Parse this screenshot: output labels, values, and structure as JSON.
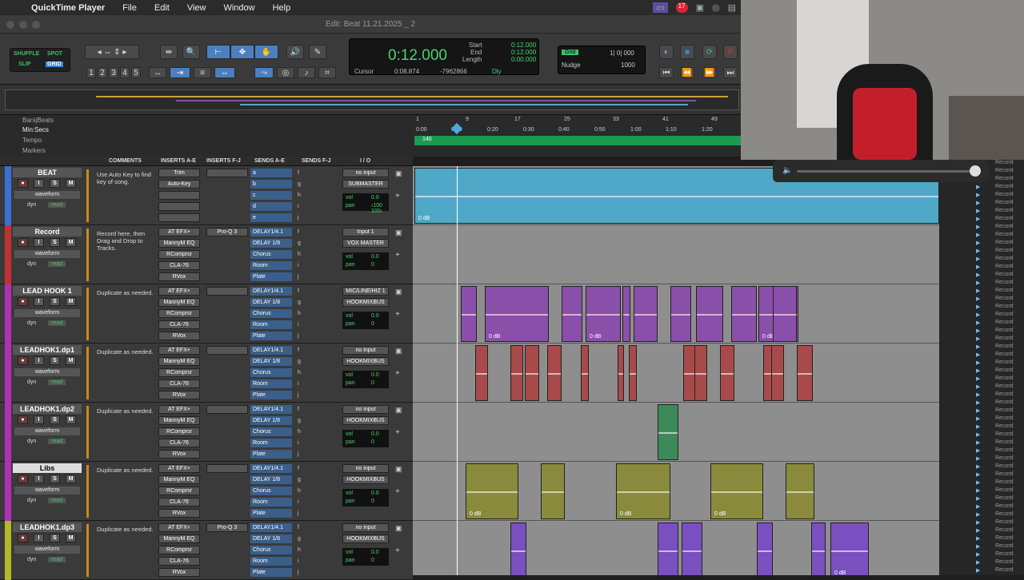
{
  "menubar": {
    "app": "QuickTime Player",
    "items": [
      "File",
      "Edit",
      "View",
      "Window",
      "Help"
    ],
    "badge": "17"
  },
  "window": {
    "title": "Edit: Beat 11.21.2025 _ 2"
  },
  "modes": {
    "shuffle": "SHUFFLE",
    "spot": "SPOT",
    "slip": "SLIP",
    "grid": "GRID"
  },
  "zoom_presets": [
    "1",
    "2",
    "3",
    "4",
    "5"
  ],
  "counter": {
    "main": "0:12.000",
    "start_label": "Start",
    "end_label": "End",
    "length_label": "Length",
    "start": "0:12.000",
    "end": "0:12.000",
    "length": "0:00.000",
    "cursor_label": "Cursor",
    "cursor": "0:08.874",
    "sample": "-7962866",
    "dly": "Dly"
  },
  "grid": {
    "label": "Grid",
    "value": "1| 0| 000",
    "nudge_label": "Nudge",
    "nudge": "1000"
  },
  "rulers": {
    "bars_label": "Bars|Beats",
    "min_label": "Min:Secs",
    "tempo_label": "Tempo",
    "markers_label": "Markers",
    "tempo_value": "140",
    "bars": [
      "1",
      "9",
      "17",
      "25",
      "33",
      "41",
      "49"
    ],
    "secs": [
      "0:00",
      "0:10",
      "0:20",
      "0:30",
      "0:40",
      "0:50",
      "1:00",
      "1:10",
      "1:20"
    ]
  },
  "columns": {
    "comments": "COMMENTS",
    "ins_ae": "INSERTS A-E",
    "ins_fj": "INSERTS F-J",
    "sends_ae": "SENDS A-E",
    "sends_fj": "SENDS F-J",
    "io": "I / O"
  },
  "common": {
    "view": "waveform",
    "dyn": "dyn",
    "read": "read",
    "vol": "vol",
    "pan": "pan",
    "rec": "",
    "solo": "S",
    "mute": "M",
    "input": "I"
  },
  "tracks": [
    {
      "name": "BEAT",
      "color": "#3b6fd6",
      "comment": "Use Auto Key to find key of song.",
      "inserts": [
        "Trim",
        "Auto-Key",
        "",
        "",
        ""
      ],
      "inserts2": [
        "",
        "",
        "",
        "",
        ""
      ],
      "sends": [
        "a",
        "b",
        "c",
        "d",
        "e"
      ],
      "sends2": [
        "f",
        "g",
        "h",
        "i",
        "j"
      ],
      "input": "no input",
      "output": "SUBMASTER",
      "vol": "0.0",
      "pan": "‹100  100›"
    },
    {
      "name": "Record",
      "color": "#c23131",
      "comment": "Record here, then Drag and Drop to Tracks.",
      "inserts": [
        "AT EFX+",
        "MannyM EQ",
        "RComprsr",
        "CLA-76",
        "RVox"
      ],
      "inserts2": [
        "Pro-Q 3",
        "",
        "",
        "",
        ""
      ],
      "sends": [
        "DELAY1/4.1",
        "DELAY 1/8",
        "Chorus",
        "Room",
        "Plate"
      ],
      "sends2": [
        "f",
        "g",
        "h",
        "i",
        "j"
      ],
      "input": "Input 1",
      "output": "VOX MASTER",
      "vol": "0.0",
      "pan": "0"
    },
    {
      "name": "LEAD HOOK 1",
      "color": "#b02fb5",
      "comment": "Duplicate as needed.",
      "inserts": [
        "AT EFX+",
        "MannyM EQ",
        "RComprsr",
        "CLA-76",
        "RVox"
      ],
      "inserts2": [
        "",
        "",
        "",
        "",
        ""
      ],
      "sends": [
        "DELAY1/4.1",
        "DELAY 1/8",
        "Chorus",
        "Room",
        "Plate"
      ],
      "sends2": [
        "f",
        "g",
        "h",
        "i",
        "j"
      ],
      "input": "MIC/LINE/HIZ 1",
      "output": "HOOKMIXBUS",
      "vol": "0.0",
      "pan": "0"
    },
    {
      "name": "LEADHOK1.dp1",
      "color": "#b02fb5",
      "comment": "Duplicate as needed.",
      "inserts": [
        "AT EFX+",
        "MannyM EQ",
        "RComprsr",
        "CLA-76",
        "RVox"
      ],
      "inserts2": [
        "",
        "",
        "",
        "",
        ""
      ],
      "sends": [
        "DELAY1/4.1",
        "DELAY 1/8",
        "Chorus",
        "Room",
        "Plate"
      ],
      "sends2": [
        "f",
        "g",
        "h",
        "i",
        "j"
      ],
      "input": "no input",
      "output": "HOOKMIXBUS",
      "vol": "0.0",
      "pan": "0"
    },
    {
      "name": "LEADHOK1.dp2",
      "color": "#b02fb5",
      "comment": "Duplicate as needed.",
      "inserts": [
        "AT EFX+",
        "MannyM EQ",
        "RComprsr",
        "CLA-76",
        "RVox"
      ],
      "inserts2": [
        "",
        "",
        "",
        "",
        ""
      ],
      "sends": [
        "DELAY1/4.1",
        "DELAY 1/8",
        "Chorus",
        "Room",
        "Plate"
      ],
      "sends2": [
        "f",
        "g",
        "h",
        "i",
        "j"
      ],
      "input": "no input",
      "output": "HOOKMIXBUS",
      "vol": "0.0",
      "pan": "0"
    },
    {
      "name": "Libs",
      "color": "#b02fb5",
      "comment": "Duplicate as needed.",
      "inserts": [
        "AT EFX+",
        "MannyM EQ",
        "RComprsr",
        "CLA-76",
        "RVox"
      ],
      "inserts2": [
        "",
        "",
        "",
        "",
        ""
      ],
      "sends": [
        "DELAY1/4.1",
        "DELAY 1/8",
        "Chorus",
        "Room",
        "Plate"
      ],
      "sends2": [
        "f",
        "g",
        "h",
        "i",
        "j"
      ],
      "input": "no input",
      "output": "HOOKMIXBUS",
      "vol": "0.0",
      "pan": "0"
    },
    {
      "name": "LEADHOK1.dp3",
      "color": "#b6b62a",
      "comment": "Duplicate as needed.",
      "inserts": [
        "AT EFX+",
        "MannyM EQ",
        "RComprsr",
        "CLA-76",
        "RVox"
      ],
      "inserts2": [
        "Pro-Q 3",
        "",
        "",
        "",
        ""
      ],
      "sends": [
        "DELAY1/4.1",
        "DELAY 1/8",
        "Chorus",
        "Room",
        "Plate"
      ],
      "sends2": [
        "f",
        "g",
        "h",
        "i",
        "j"
      ],
      "input": "no input",
      "output": "HOOKMIXBUS",
      "vol": "0.0",
      "pan": "0"
    }
  ],
  "clip_gain": "0 dB",
  "clip_gain_trunc": "0 dl",
  "clip_colors": {
    "beat": "#4fa8c7",
    "hook": "#8a4fa8",
    "dp1": "#a84a4a",
    "dp2": "#3c8a5a",
    "libs": "#8a8a3c",
    "dp3": "#7a4fc0"
  },
  "right_list": {
    "items": [
      "Record",
      "Record",
      "Record",
      "Record",
      "Record",
      "Record",
      "Record",
      "Record",
      "Record",
      "Record",
      "Record",
      "Record",
      "Record",
      "Record",
      "Record",
      "Record",
      "Record",
      "Record",
      "Record",
      "Record",
      "Record",
      "Record",
      "Record",
      "Record",
      "Record",
      "Record",
      "Record",
      "Record",
      "Record",
      "Record",
      "Record",
      "Record",
      "Record",
      "Record",
      "Record",
      "Record",
      "Record",
      "Record",
      "Record",
      "Record",
      "Record",
      "Record",
      "Record",
      "Record",
      "Record",
      "Record",
      "Record",
      "Record",
      "Record",
      "Record",
      "Record",
      "Record"
    ]
  }
}
